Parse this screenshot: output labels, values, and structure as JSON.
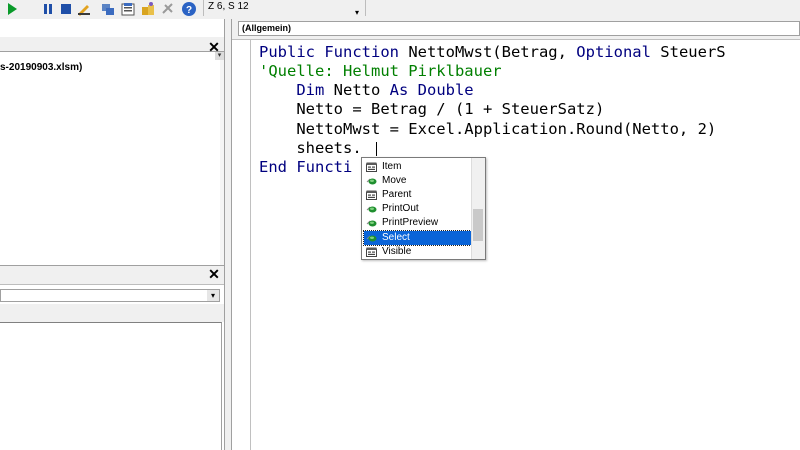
{
  "toolbar": {
    "icons": [
      "run-icon",
      "break-icon",
      "reset-icon",
      "design-mode-icon",
      "project-explorer-icon",
      "properties-icon",
      "object-browser-icon",
      "toolbox-icon",
      "help-icon"
    ],
    "cursor_position": "Z 6, S 12"
  },
  "project": {
    "item_label": "s-20190903.xlsm)"
  },
  "code": {
    "object_combo_value": "(Allgemein)",
    "lines": [
      {
        "parts": [
          {
            "t": "Public Function ",
            "k": "kw"
          },
          {
            "t": "NettoMwst(Betrag, ",
            "k": ""
          },
          {
            "t": "Optional",
            "k": "kw"
          },
          {
            "t": " SteuerS",
            "k": ""
          }
        ]
      },
      {
        "parts": [
          {
            "t": "'Quelle: Helmut Pirklbauer",
            "k": "cm"
          }
        ]
      },
      {
        "parts": [
          {
            "t": "    Dim",
            "k": "kw"
          },
          {
            "t": " Netto ",
            "k": ""
          },
          {
            "t": "As Double",
            "k": "kw"
          }
        ]
      },
      {
        "parts": [
          {
            "t": "    Netto = Betrag / (1 + SteuerSatz)",
            "k": ""
          }
        ]
      },
      {
        "parts": [
          {
            "t": "    NettoMwst = Excel.Application.Round(Netto, 2)",
            "k": ""
          }
        ]
      },
      {
        "parts": [
          {
            "t": "    sheets.",
            "k": ""
          }
        ]
      },
      {
        "parts": [
          {
            "t": "End Functi",
            "k": "kw"
          }
        ]
      }
    ]
  },
  "intellisense": {
    "items": [
      {
        "label": "Item",
        "icon": "property-icon",
        "selected": false
      },
      {
        "label": "Move",
        "icon": "method-icon",
        "selected": false
      },
      {
        "label": "Parent",
        "icon": "property-icon",
        "selected": false
      },
      {
        "label": "PrintOut",
        "icon": "method-icon",
        "selected": false
      },
      {
        "label": "PrintPreview",
        "icon": "method-icon",
        "selected": false
      },
      {
        "label": "Select",
        "icon": "method-icon",
        "selected": true
      },
      {
        "label": "Visible",
        "icon": "property-icon",
        "selected": false
      }
    ]
  },
  "colors": {
    "keyword": "#00007f",
    "comment": "#007f00",
    "selection": "#0a64d8"
  }
}
